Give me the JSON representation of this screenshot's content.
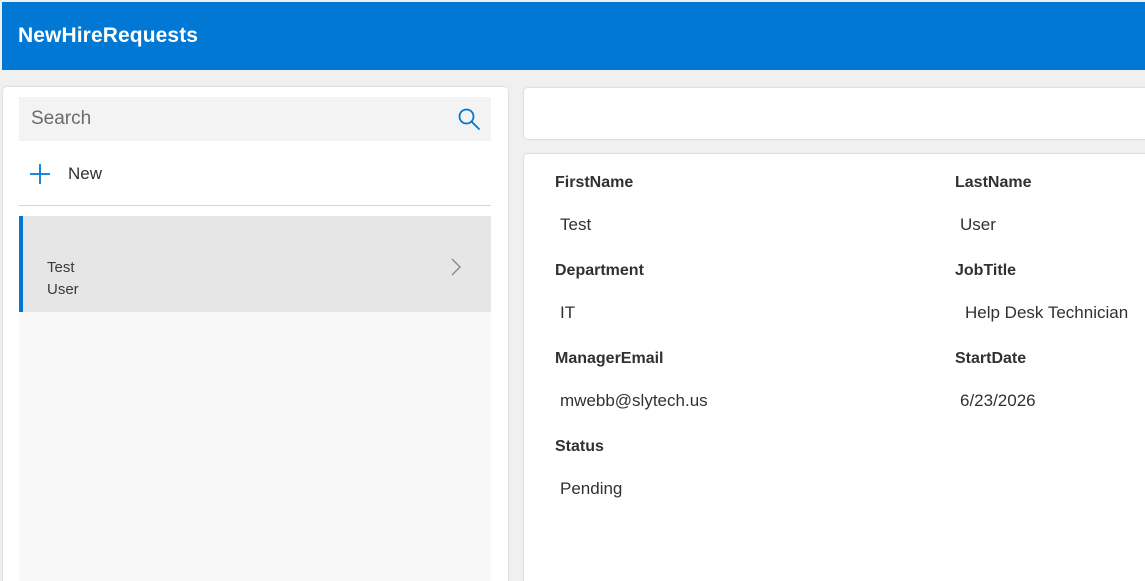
{
  "app": {
    "title": "NewHireRequests"
  },
  "search": {
    "placeholder": "Search",
    "value": ""
  },
  "actions": {
    "new_label": "New"
  },
  "gallery": {
    "items": [
      {
        "first": "Test",
        "last": "User",
        "selected": true
      }
    ]
  },
  "form": {
    "fields": [
      {
        "label": "FirstName",
        "value": "Test"
      },
      {
        "label": "LastName",
        "value": "User"
      },
      {
        "label": "Department",
        "value": "IT"
      },
      {
        "label": "JobTitle",
        "value": "Help Desk Technician"
      },
      {
        "label": "ManagerEmail",
        "value": "mwebb@slytech.us"
      },
      {
        "label": "StartDate",
        "value": "6/23/2026"
      },
      {
        "label": "Status",
        "value": "Pending"
      }
    ]
  },
  "colors": {
    "brand": "#0078d4",
    "header_text": "#ffffff",
    "selected_item_bg": "#e6e6e6",
    "search_bg": "#f3f3f3"
  },
  "icons": {
    "search": "search-icon",
    "add": "plus-icon",
    "navigate": "chevron-right-icon"
  }
}
